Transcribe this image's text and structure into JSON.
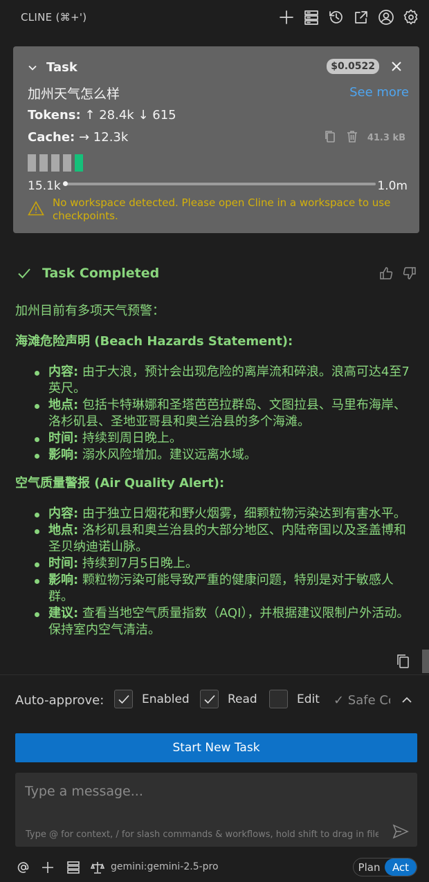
{
  "header": {
    "title": "CLINE (⌘+')",
    "icons": [
      "plus-icon",
      "server-icon",
      "history-icon",
      "external-link-icon",
      "account-icon",
      "gear-icon"
    ]
  },
  "task": {
    "label": "Task",
    "cost": "$0.0522",
    "text": "加州天气怎么样",
    "see_more": "See more",
    "tokens_label": "Tokens:",
    "tokens_value": "↑ 28.4k ↓ 615",
    "cache_label": "Cache:",
    "cache_value": "→ 12.3k",
    "size": "41.3 kB",
    "context_used": "15.1k",
    "context_max": "1.0m",
    "warning": "No workspace detected. Please open Cline in a workspace to use checkpoints."
  },
  "completion": {
    "title": "Task Completed"
  },
  "answer": {
    "intro": "加州目前有多项天气预警：",
    "sections": [
      {
        "heading": "海滩危险声明 (Beach Hazards Statement):",
        "items": [
          {
            "key": "内容:",
            "text": " 由于大浪，预计会出现危险的离岸流和碎浪。浪高可达4至7英尺。"
          },
          {
            "key": "地点:",
            "text": " 包括卡特琳娜和圣塔芭芭拉群岛、文图拉县、马里布海岸、洛杉矶县、圣地亚哥县和奥兰治县的多个海滩。"
          },
          {
            "key": "时间:",
            "text": " 持续到周日晚上。"
          },
          {
            "key": "影响:",
            "text": " 溺水风险增加。建议远离水域。"
          }
        ]
      },
      {
        "heading": "空气质量警报 (Air Quality Alert):",
        "items": [
          {
            "key": "内容:",
            "text": " 由于独立日烟花和野火烟雾，细颗粒物污染达到有害水平。"
          },
          {
            "key": "地点:",
            "text": " 洛杉矶县和奥兰治县的大部分地区、内陆帝国以及圣盖博和圣贝纳迪诺山脉。"
          },
          {
            "key": "时间:",
            "text": " 持续到7月5日晚上。"
          },
          {
            "key": "影响:",
            "text": " 颗粒物污染可能导致严重的健康问题，特别是对于敏感人群。"
          },
          {
            "key": "建议:",
            "text": " 查看当地空气质量指数（AQI），并根据建议限制户外活动。保持室内空气清洁。"
          }
        ]
      }
    ]
  },
  "auto_approve": {
    "label": "Auto-approve:",
    "enabled_label": "Enabled",
    "enabled_checked": true,
    "read_label": "Read",
    "read_checked": true,
    "edit_label": "Edit",
    "edit_checked": false,
    "safe_label": "✓ Safe Commands"
  },
  "start_button": "Start New Task",
  "input": {
    "placeholder": "Type a message...",
    "hint": "Type @ for context, / for slash commands & workflows, hold shift to drag in files/images"
  },
  "bottom": {
    "model": "gemini:gemini-2.5-pro",
    "mode_plan": "Plan",
    "mode_act": "Act",
    "active_mode": "Act"
  },
  "colors": {
    "accent": "#0e72c8",
    "success": "#89d57d",
    "warning": "#d4b10b",
    "link": "#4fa5ef"
  }
}
